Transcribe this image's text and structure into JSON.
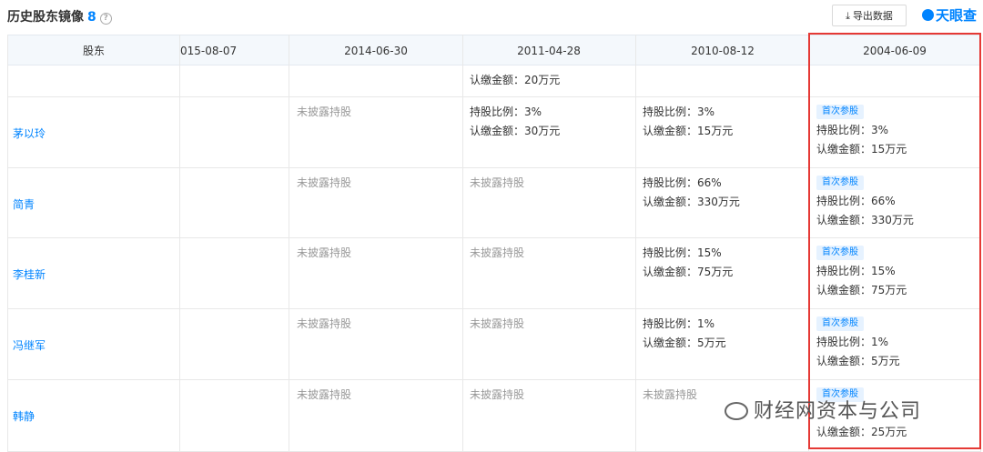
{
  "header": {
    "title": "历史股东镜像",
    "count": "8",
    "help": "?",
    "export_label": "导出数据",
    "logo_text": "天眼查"
  },
  "columns": [
    "股东",
    "015-08-07",
    "2014-06-30",
    "2011-04-28",
    "2010-08-12",
    "2004-06-09"
  ],
  "top_partial": {
    "c3": "认缴金额：20万元"
  },
  "rows": [
    {
      "name": "茅以玲",
      "c2": "未披露持股",
      "c3": [
        "持股比例：3%",
        "认缴金额：30万元"
      ],
      "c4": [
        "持股比例：3%",
        "认缴金额：15万元"
      ],
      "c5": {
        "tag": "首次参股",
        "lines": [
          "持股比例：3%",
          "认缴金额：15万元"
        ]
      }
    },
    {
      "name": "简青",
      "c2": "未披露持股",
      "c3": "未披露持股",
      "c4": [
        "持股比例：66%",
        "认缴金额：330万元"
      ],
      "c5": {
        "tag": "首次参股",
        "lines": [
          "持股比例：66%",
          "认缴金额：330万元"
        ]
      }
    },
    {
      "name": "李桂新",
      "c2": "未披露持股",
      "c3": "未披露持股",
      "c4": [
        "持股比例：15%",
        "认缴金额：75万元"
      ],
      "c5": {
        "tag": "首次参股",
        "lines": [
          "持股比例：15%",
          "认缴金额：75万元"
        ]
      }
    },
    {
      "name": "冯继军",
      "c2": "未披露持股",
      "c3": "未披露持股",
      "c4": [
        "持股比例：1%",
        "认缴金额：5万元"
      ],
      "c5": {
        "tag": "首次参股",
        "lines": [
          "持股比例：1%",
          "认缴金额：5万元"
        ]
      }
    },
    {
      "name": "韩静",
      "c2": "未披露持股",
      "c3": "未披露持股",
      "c4": "未披露持股",
      "c5": {
        "tag": "首次参股",
        "lines": [
          "认缴金额：25万元"
        ]
      }
    }
  ],
  "watermark": "财经网资本与公司",
  "colors": {
    "accent": "#0084ff",
    "tag_bg": "#e6f2ff",
    "highlight": "#e53935",
    "header_bg": "#f4f8fc"
  }
}
